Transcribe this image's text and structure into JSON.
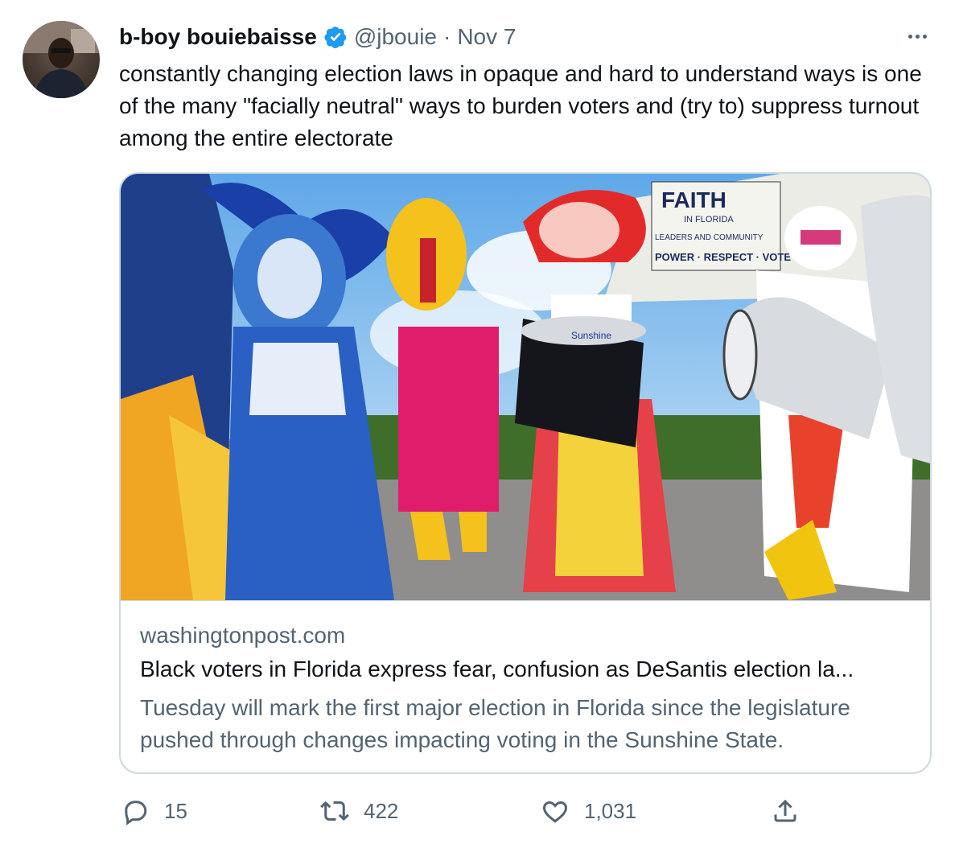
{
  "tweet": {
    "author_name": "b-boy bouiebaisse",
    "handle": "@jbouie",
    "separator": "·",
    "date": "Nov 7",
    "text": "constantly changing election laws in opaque and hard to understand ways is one of the many \"facially neutral\" ways to burden voters and (try to) suppress turnout among the entire electorate"
  },
  "card": {
    "domain": "washingtonpost.com",
    "title": "Black voters in Florida express fear, confusion as DeSantis election la...",
    "description": "Tuesday will mark the first major election in Florida since the legislature pushed through changes impacting voting in the Sunshine State.",
    "banner_lines": [
      "FAITH",
      "IN FLORIDA",
      "LEADERS AND COMMUNITY",
      "POWER · RESPECT · VOTE"
    ],
    "drum_label": "Sunshine"
  },
  "actions": {
    "reply_count": "15",
    "retweet_count": "422",
    "like_count": "1,031"
  },
  "colors": {
    "text_primary": "#0f1419",
    "text_secondary": "#536471",
    "border": "#cfd9de",
    "verified_blue": "#1d9bf0"
  },
  "icons": [
    "verified-badge-icon",
    "more-icon",
    "reply-icon",
    "retweet-icon",
    "like-icon",
    "share-icon"
  ]
}
